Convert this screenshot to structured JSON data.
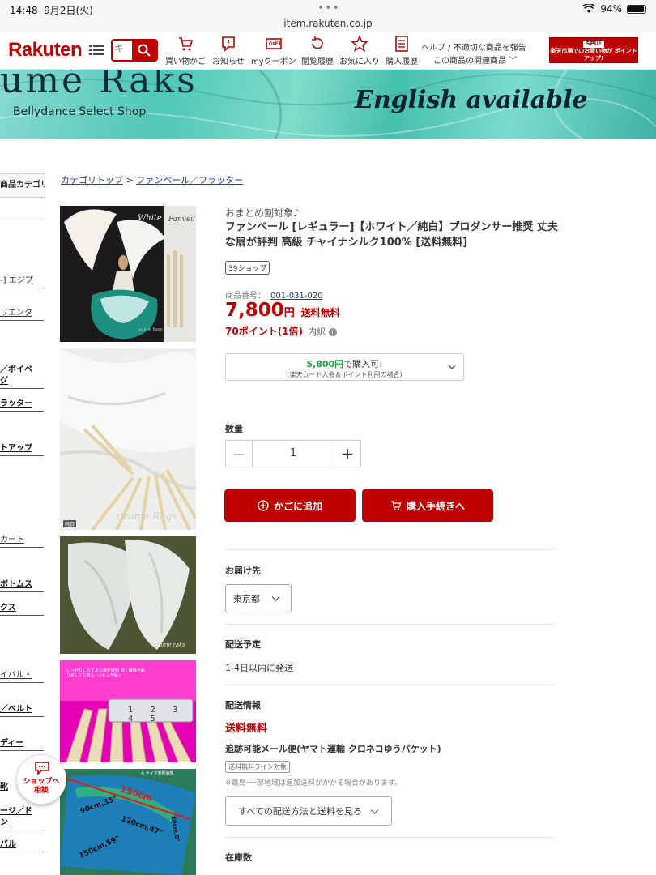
{
  "status_bar": {
    "time": "14:48",
    "date": "9月2日(火)",
    "dots": "•••",
    "url": "item.rakuten.co.jp",
    "battery": "94%"
  },
  "header": {
    "logo": "Rakuten",
    "search_placeholder": "キ",
    "nav": [
      {
        "label": "買い物かご",
        "icon": "cart-icon"
      },
      {
        "label": "お知らせ",
        "icon": "notification-icon"
      },
      {
        "label": "myクーポン",
        "icon": "coupon-icon"
      },
      {
        "label": "閲覧履歴",
        "icon": "history-icon"
      },
      {
        "label": "お気に入り",
        "icon": "star-icon"
      },
      {
        "label": "購入履歴",
        "icon": "receipt-icon"
      }
    ],
    "help": "ヘルプ / 不適切な商品を報告",
    "related": "この商品の関連商品",
    "spu_badge_top": "SPU!",
    "spu_badge_text": "楽天市場でのお買い物が ポイントアップ!"
  },
  "banner": {
    "shop": "umé Raks",
    "subtitle": "Bellydance Select Shop",
    "english": "English available"
  },
  "sidebar": {
    "tab": "商品カテゴリ",
    "items": [
      {
        "label": "-] エジプ",
        "style": "under"
      },
      {
        "label": "リエンタ",
        "style": "under"
      },
      {
        "label": "／ボイベ",
        "style": "bold"
      },
      {
        "label": "グ",
        "style": "bold"
      },
      {
        "label": "ラッター",
        "style": "bold"
      },
      {
        "label": "トアップ",
        "style": "bold"
      },
      {
        "label": "カート",
        "style": "under"
      },
      {
        "label": "ボトムス",
        "style": "bold"
      },
      {
        "label": "クス",
        "style": "bold"
      },
      {
        "label": "イバル・",
        "style": "under"
      },
      {
        "label": "／ベルト",
        "style": "bold"
      },
      {
        "label": "ディー",
        "style": "bold"
      },
      {
        "label": "靴",
        "style": "bold"
      },
      {
        "label": "ージ／ド",
        "style": "bold"
      },
      {
        "label": "ン",
        "style": "bold"
      },
      {
        "label": "バル",
        "style": "bold"
      }
    ]
  },
  "breadcrumb": {
    "top": "カテゴリトップ",
    "sep": ">",
    "current": "ファンベール／フラッター"
  },
  "thumbs": {
    "t1_tag1": "White",
    "t1_tag2": "Fanveil",
    "t1_brand": "uzume Raqs",
    "t2_tag": "純白",
    "t2_brand": "uzume Raqs",
    "t3_brand": "uzume raks",
    "t4_note": "しっかりした丈夫な扇が評判 扱く破損を繰り返しても安心 ~1センチ幅~",
    "t4_ruler": "1 2 3 4 5",
    "t5_note": "※ サイズ参照画像",
    "t5_len": "150cm",
    "t5_labels": [
      "90cm,35\"",
      "120cm,47\"",
      "150cm,59\"",
      "20cm,8\""
    ]
  },
  "product": {
    "catch": "おまとめ割対象♪",
    "title": "ファンベール [レギュラー]【ホワイト／純白】プロダンサー推奨 丈夫な扇が評判 高級 チャイナシルク100% [送料無料]",
    "shop_badge": "39ショップ",
    "sku_label": "商品番号：",
    "sku": "001-031-020",
    "price": "7,800",
    "yen": "円",
    "ship_label": "送料無料",
    "points": "70ポイント(1倍)",
    "breakdown": "内訳",
    "promo_price": "5,800円",
    "promo_suffix": "で購入可!",
    "promo_note": "(楽天カード入会＆ポイント利用の場合)",
    "qty_label": "数量",
    "qty": "1",
    "add_to_cart": "かごに追加",
    "checkout": "購入手続きへ",
    "delivery_to": "お届け先",
    "pref": "東京都",
    "schedule_label": "配送予定",
    "schedule": "1-4日以内に発送",
    "shipping_info": "配送情報",
    "free_ship": "送料無料",
    "method": "追跡可能メール便(ヤマト運輸 クロネコゆうパケット)",
    "method_tag": "送料無料ライン対象",
    "note": "※離島･一部地域は追加送料がかかる場合があります。",
    "all_shipping": "すべての配送方法と送料を見る",
    "stock_label": "在庫数"
  },
  "shop_bubble": {
    "line1": "ショップへ",
    "line2": "相談"
  },
  "colors": {
    "accent": "#bf0000",
    "link": "#1c3ca8",
    "promo_green": "#24a33a"
  }
}
